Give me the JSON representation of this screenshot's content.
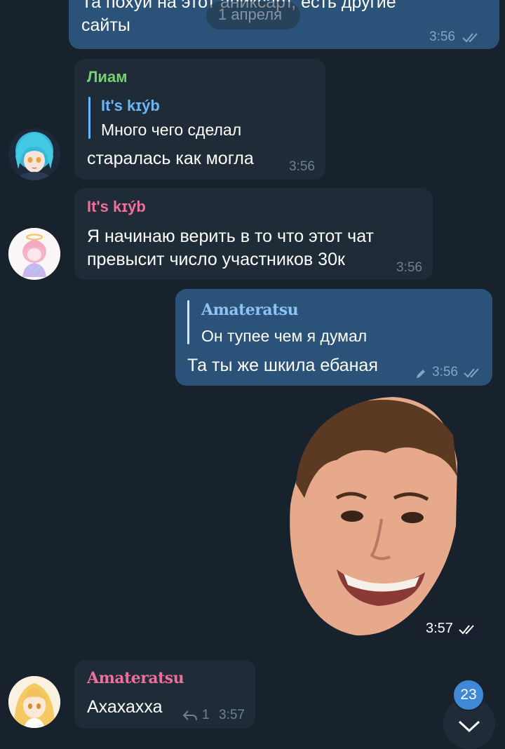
{
  "date_badge": "1 апреля",
  "messages": {
    "m1": {
      "text_line1": "Та похуй на этот аниксарт, есть другие",
      "text_line2": "сайты",
      "time": "3:56"
    },
    "m2": {
      "sender": "Лиам",
      "reply_name": "It's kɪýb",
      "reply_text": "Много чего сделал",
      "text": "старалась как могла",
      "time": "3:56"
    },
    "m3": {
      "sender": "It's kɪýb",
      "text_line1": "Я начинаю верить в то что этот чат",
      "text_line2": "превысит число участников 30к",
      "time": "3:56"
    },
    "m4": {
      "reply_name": "Amateratsu",
      "reply_text": "Он тупее чем я думал",
      "text": "Та ты же шкила ебаная",
      "time": "3:56"
    },
    "m5": {
      "time": "3:57"
    },
    "m6": {
      "sender": "Amateratsu",
      "text": "Ахахахха",
      "replies_count": "1",
      "time": "3:57"
    }
  },
  "unread_badge": "23",
  "icons": {
    "read": "double-check-icon",
    "edited": "pencil-icon",
    "reply": "reply-icon",
    "scroll": "chevron-down-icon"
  },
  "colors": {
    "background": "#18222d",
    "incoming_bubble": "#1f2c38",
    "outgoing_bubble": "#2b5278",
    "name_green": "#74d36e",
    "name_pink": "#ee6f9a",
    "reply_blue": "#6ab7f5",
    "reply_blue_out": "#8dc3f0",
    "badge_blue": "#3e88d6"
  }
}
